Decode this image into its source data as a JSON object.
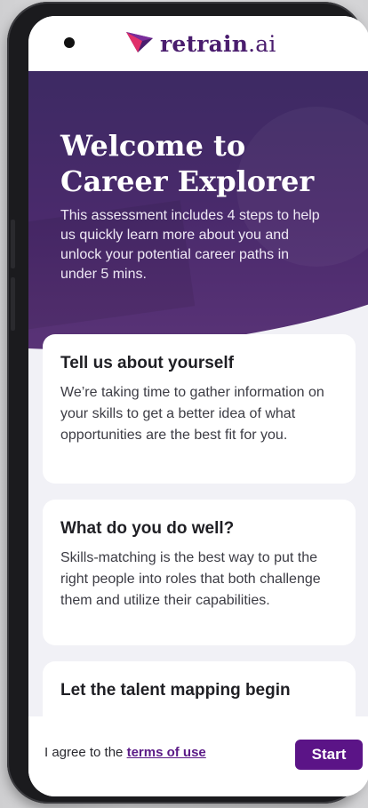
{
  "header": {
    "logo_text": "retrain",
    "logo_suffix": ".ai",
    "logo_icon": "retrain-logo-icon"
  },
  "hero": {
    "title": "Welcome to Career Explorer",
    "subtitle": "This assessment includes 4 steps to help us quickly learn more about you and unlock your potential career paths in under 5 mins."
  },
  "cards": [
    {
      "title": "Tell us about yourself",
      "body": "We’re taking time to gather information on your skills to get a better idea of what opportunities are the best fit for you."
    },
    {
      "title": "What do you do well?",
      "body": "Skills-matching is the best way to put the right people into roles that both challenge them and utilize their capabilities."
    },
    {
      "title": "Let the talent mapping begin",
      "body": ""
    }
  ],
  "footer": {
    "agree_text": "I agree to the ",
    "terms_link": "terms of use",
    "start_label": "Start"
  },
  "colors": {
    "brand": "#5b1487",
    "hero_bg": "#3d2a63",
    "logo_pink": "#e0306a"
  }
}
